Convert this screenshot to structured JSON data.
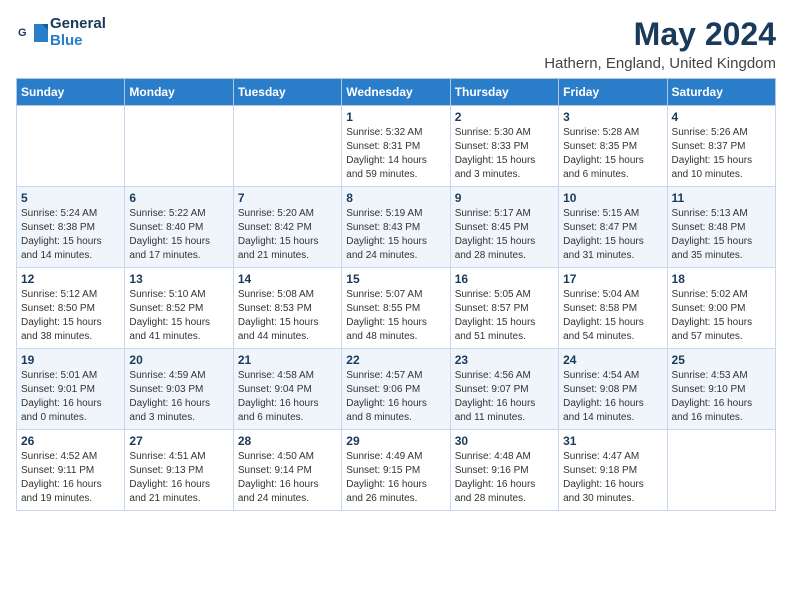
{
  "logo": {
    "general": "General",
    "blue": "Blue"
  },
  "title": "May 2024",
  "location": "Hathern, England, United Kingdom",
  "days_of_week": [
    "Sunday",
    "Monday",
    "Tuesday",
    "Wednesday",
    "Thursday",
    "Friday",
    "Saturday"
  ],
  "weeks": [
    [
      {
        "day": "",
        "detail": ""
      },
      {
        "day": "",
        "detail": ""
      },
      {
        "day": "",
        "detail": ""
      },
      {
        "day": "1",
        "detail": "Sunrise: 5:32 AM\nSunset: 8:31 PM\nDaylight: 14 hours\nand 59 minutes."
      },
      {
        "day": "2",
        "detail": "Sunrise: 5:30 AM\nSunset: 8:33 PM\nDaylight: 15 hours\nand 3 minutes."
      },
      {
        "day": "3",
        "detail": "Sunrise: 5:28 AM\nSunset: 8:35 PM\nDaylight: 15 hours\nand 6 minutes."
      },
      {
        "day": "4",
        "detail": "Sunrise: 5:26 AM\nSunset: 8:37 PM\nDaylight: 15 hours\nand 10 minutes."
      }
    ],
    [
      {
        "day": "5",
        "detail": "Sunrise: 5:24 AM\nSunset: 8:38 PM\nDaylight: 15 hours\nand 14 minutes."
      },
      {
        "day": "6",
        "detail": "Sunrise: 5:22 AM\nSunset: 8:40 PM\nDaylight: 15 hours\nand 17 minutes."
      },
      {
        "day": "7",
        "detail": "Sunrise: 5:20 AM\nSunset: 8:42 PM\nDaylight: 15 hours\nand 21 minutes."
      },
      {
        "day": "8",
        "detail": "Sunrise: 5:19 AM\nSunset: 8:43 PM\nDaylight: 15 hours\nand 24 minutes."
      },
      {
        "day": "9",
        "detail": "Sunrise: 5:17 AM\nSunset: 8:45 PM\nDaylight: 15 hours\nand 28 minutes."
      },
      {
        "day": "10",
        "detail": "Sunrise: 5:15 AM\nSunset: 8:47 PM\nDaylight: 15 hours\nand 31 minutes."
      },
      {
        "day": "11",
        "detail": "Sunrise: 5:13 AM\nSunset: 8:48 PM\nDaylight: 15 hours\nand 35 minutes."
      }
    ],
    [
      {
        "day": "12",
        "detail": "Sunrise: 5:12 AM\nSunset: 8:50 PM\nDaylight: 15 hours\nand 38 minutes."
      },
      {
        "day": "13",
        "detail": "Sunrise: 5:10 AM\nSunset: 8:52 PM\nDaylight: 15 hours\nand 41 minutes."
      },
      {
        "day": "14",
        "detail": "Sunrise: 5:08 AM\nSunset: 8:53 PM\nDaylight: 15 hours\nand 44 minutes."
      },
      {
        "day": "15",
        "detail": "Sunrise: 5:07 AM\nSunset: 8:55 PM\nDaylight: 15 hours\nand 48 minutes."
      },
      {
        "day": "16",
        "detail": "Sunrise: 5:05 AM\nSunset: 8:57 PM\nDaylight: 15 hours\nand 51 minutes."
      },
      {
        "day": "17",
        "detail": "Sunrise: 5:04 AM\nSunset: 8:58 PM\nDaylight: 15 hours\nand 54 minutes."
      },
      {
        "day": "18",
        "detail": "Sunrise: 5:02 AM\nSunset: 9:00 PM\nDaylight: 15 hours\nand 57 minutes."
      }
    ],
    [
      {
        "day": "19",
        "detail": "Sunrise: 5:01 AM\nSunset: 9:01 PM\nDaylight: 16 hours\nand 0 minutes."
      },
      {
        "day": "20",
        "detail": "Sunrise: 4:59 AM\nSunset: 9:03 PM\nDaylight: 16 hours\nand 3 minutes."
      },
      {
        "day": "21",
        "detail": "Sunrise: 4:58 AM\nSunset: 9:04 PM\nDaylight: 16 hours\nand 6 minutes."
      },
      {
        "day": "22",
        "detail": "Sunrise: 4:57 AM\nSunset: 9:06 PM\nDaylight: 16 hours\nand 8 minutes."
      },
      {
        "day": "23",
        "detail": "Sunrise: 4:56 AM\nSunset: 9:07 PM\nDaylight: 16 hours\nand 11 minutes."
      },
      {
        "day": "24",
        "detail": "Sunrise: 4:54 AM\nSunset: 9:08 PM\nDaylight: 16 hours\nand 14 minutes."
      },
      {
        "day": "25",
        "detail": "Sunrise: 4:53 AM\nSunset: 9:10 PM\nDaylight: 16 hours\nand 16 minutes."
      }
    ],
    [
      {
        "day": "26",
        "detail": "Sunrise: 4:52 AM\nSunset: 9:11 PM\nDaylight: 16 hours\nand 19 minutes."
      },
      {
        "day": "27",
        "detail": "Sunrise: 4:51 AM\nSunset: 9:13 PM\nDaylight: 16 hours\nand 21 minutes."
      },
      {
        "day": "28",
        "detail": "Sunrise: 4:50 AM\nSunset: 9:14 PM\nDaylight: 16 hours\nand 24 minutes."
      },
      {
        "day": "29",
        "detail": "Sunrise: 4:49 AM\nSunset: 9:15 PM\nDaylight: 16 hours\nand 26 minutes."
      },
      {
        "day": "30",
        "detail": "Sunrise: 4:48 AM\nSunset: 9:16 PM\nDaylight: 16 hours\nand 28 minutes."
      },
      {
        "day": "31",
        "detail": "Sunrise: 4:47 AM\nSunset: 9:18 PM\nDaylight: 16 hours\nand 30 minutes."
      },
      {
        "day": "",
        "detail": ""
      }
    ]
  ]
}
